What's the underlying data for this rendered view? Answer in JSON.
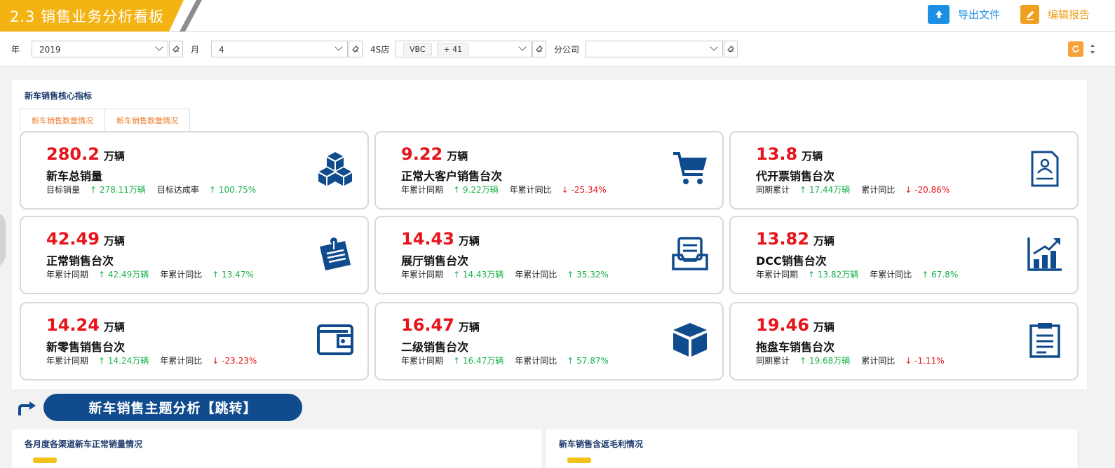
{
  "header": {
    "title": "2.3 销售业务分析看板",
    "export_label": "导出文件",
    "edit_label": "编辑报告",
    "export_color": "#1a8fe3",
    "edit_color": "#f0a01e"
  },
  "filters": {
    "year_label": "年",
    "year_value": "2019",
    "month_label": "月",
    "month_value": "4",
    "store_label": "4S店",
    "store_tag": "VBC",
    "store_more": "+ 41",
    "branch_label": "分公司",
    "branch_value": ""
  },
  "core": {
    "title": "新车销售核心指标",
    "tabs": [
      "新车销售数量情况",
      "新车销售数量情况"
    ],
    "cards": [
      {
        "value": "280.2",
        "unit": "万辆",
        "name": "新车总销量",
        "m1_label": "目标销量",
        "m1_dir": "up",
        "m1_value": "278.11万辆",
        "m2_label": "目标达成率",
        "m2_dir": "up",
        "m2_value": "100.75%",
        "icon": "cubes-icon"
      },
      {
        "value": "9.22",
        "unit": "万辆",
        "name": "正常大客户销售台次",
        "m1_label": "年累计同期",
        "m1_dir": "up",
        "m1_value": "9.22万辆",
        "m2_label": "年累计同比",
        "m2_dir": "down",
        "m2_value": "-25.34%",
        "icon": "cart-icon"
      },
      {
        "value": "13.8",
        "unit": "万辆",
        "name": "代开票销售台次",
        "m1_label": "同期累计",
        "m1_dir": "up",
        "m1_value": "17.44万辆",
        "m2_label": "累计同比",
        "m2_dir": "down",
        "m2_value": "-20.86%",
        "icon": "invoice-icon"
      },
      {
        "value": "42.49",
        "unit": "万辆",
        "name": "正常销售台次",
        "m1_label": "年累计同期",
        "m1_dir": "up",
        "m1_value": "42.49万辆",
        "m2_label": "年累计同比",
        "m2_dir": "up",
        "m2_value": "13.47%",
        "icon": "clipboard-pin-icon"
      },
      {
        "value": "14.43",
        "unit": "万辆",
        "name": "展厅销售台次",
        "m1_label": "年累计同期",
        "m1_dir": "up",
        "m1_value": "14.43万辆",
        "m2_label": "年累计同比",
        "m2_dir": "up",
        "m2_value": "35.32%",
        "icon": "showroom-icon"
      },
      {
        "value": "13.82",
        "unit": "万辆",
        "name": "DCC销售台次",
        "m1_label": "年累计同期",
        "m1_dir": "up",
        "m1_value": "13.82万辆",
        "m2_label": "年累计同比",
        "m2_dir": "up",
        "m2_value": "67.8%",
        "icon": "bar-chart-icon"
      },
      {
        "value": "14.24",
        "unit": "万辆",
        "name": "新零售销售台次",
        "m1_label": "年累计同期",
        "m1_dir": "up",
        "m1_value": "14.24万辆",
        "m2_label": "年累计同比",
        "m2_dir": "down",
        "m2_value": "-23.23%",
        "icon": "wallet-icon"
      },
      {
        "value": "16.47",
        "unit": "万辆",
        "name": "二级销售台次",
        "m1_label": "年累计同期",
        "m1_dir": "up",
        "m1_value": "16.47万辆",
        "m2_label": "年累计同比",
        "m2_dir": "up",
        "m2_value": "57.87%",
        "icon": "box-icon"
      },
      {
        "value": "19.46",
        "unit": "万辆",
        "name": "拖盘车销售台次",
        "m1_label": "同期累计",
        "m1_dir": "up",
        "m1_value": "19.68万辆",
        "m2_label": "累计同比",
        "m2_dir": "down",
        "m2_value": "-1.11%",
        "icon": "document-list-icon"
      }
    ]
  },
  "jump": {
    "label": "新车销售主题分析【跳转】"
  },
  "bottom": {
    "left_title": "各月度各渠道新车正常销量情况",
    "right_title": "新车销售含返毛利情况"
  },
  "colors": {
    "accent": "#f3b312",
    "navy": "#104b8d",
    "up": "#19b24b",
    "down": "#e8141b"
  }
}
